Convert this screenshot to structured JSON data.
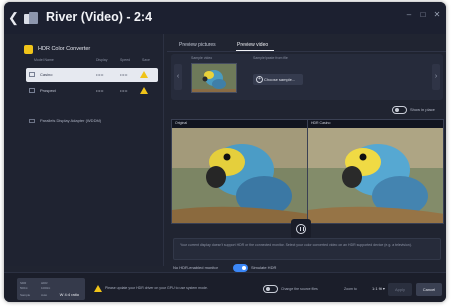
{
  "window": {
    "title": "River (Video) - 2:4",
    "back_icon": "chevron-left-icon",
    "controls": [
      "–",
      "□",
      "✕"
    ]
  },
  "left_panel": {
    "plugin_name": "HDR Color Converter",
    "columns": [
      "Model Name",
      "Display",
      "Speed",
      "Save"
    ],
    "monitors": [
      {
        "name": "Casino",
        "display": "•••••",
        "speed": "•••••",
        "selected": true,
        "warning": true
      },
      {
        "name": "Prospect",
        "display": "•••••",
        "speed": "•••••",
        "selected": false,
        "warning": true
      }
    ],
    "adapter": "Parallels Display Adapter (WDDM)"
  },
  "tabs": [
    "Preview pictures",
    "Preview video"
  ],
  "active_tab": 1,
  "strip": {
    "sample_label": "Sample video",
    "source_label": "Sample/paste from file",
    "choose_button": "Choose sample..."
  },
  "show_in_place": "Show in place",
  "previews": {
    "original_label": "Original",
    "converted_label": "HDR Casino"
  },
  "info_text": "Your current display doesn't support HDR or the connected monitor. Select your color converted video on an HDR supported device (e.g. a television).",
  "hdr_row": {
    "label": "No HDR-enabled monitor",
    "toggle_label": "Simulate HDR",
    "enabled": true
  },
  "footer": {
    "badge_cells": [
      "SDR",
      "500nt",
      "HDR",
      "1000nt",
      "Sample",
      "Auto"
    ],
    "badge_main": "W 4:4 ratio",
    "warning_text": "Please update your HDR driver on your GPU to use system mode.",
    "compare_label": "Change the source files",
    "zoom_label": "Zoom to",
    "zoom_value": "1:1 fit",
    "apply_button": "Apply",
    "cancel_button": "Cancel"
  },
  "colors": {
    "accent": "#3b87f7",
    "warning": "#f0c419",
    "window_bg": "#202431"
  }
}
